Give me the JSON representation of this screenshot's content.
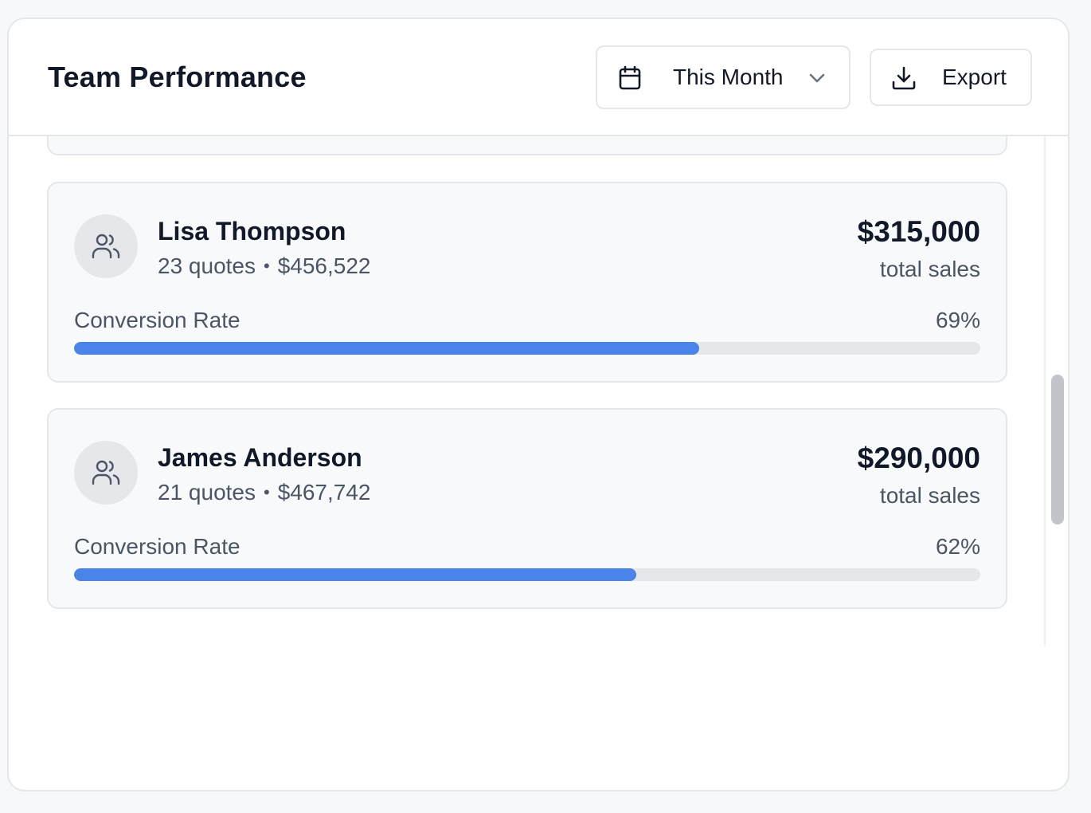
{
  "header": {
    "title": "Team Performance",
    "period_label": "This Month",
    "export_label": "Export"
  },
  "members": [
    {
      "name": "Lisa Thompson",
      "quotes": "23 quotes",
      "quote_value": "$456,522",
      "total_sales": "$315,000",
      "total_sales_label": "total sales",
      "conversion_label": "Conversion Rate",
      "conversion_rate": "69%",
      "conversion_fraction": 0.69
    },
    {
      "name": "James Anderson",
      "quotes": "21 quotes",
      "quote_value": "$467,742",
      "total_sales": "$290,000",
      "total_sales_label": "total sales",
      "conversion_label": "Conversion Rate",
      "conversion_rate": "62%",
      "conversion_fraction": 0.62
    }
  ],
  "icons": {
    "period": "calendar-icon",
    "period_dropdown": "chevron-down-icon",
    "export": "download-icon",
    "avatar": "users-icon"
  },
  "colors": {
    "progress_fill": "#4a84e8",
    "progress_track": "#e5e7eb"
  }
}
